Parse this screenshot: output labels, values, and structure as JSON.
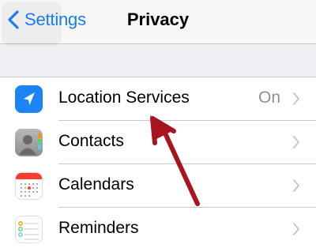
{
  "navbar": {
    "back_label": "Settings",
    "title": "Privacy"
  },
  "rows": [
    {
      "label": "Location Services",
      "value": "On",
      "icon": "location-arrow-icon"
    },
    {
      "label": "Contacts",
      "value": "",
      "icon": "contacts-icon"
    },
    {
      "label": "Calendars",
      "value": "",
      "icon": "calendar-icon"
    },
    {
      "label": "Reminders",
      "value": "",
      "icon": "reminders-icon"
    }
  ],
  "colors": {
    "accent": "#1a7cf5",
    "annotation_arrow": "#a8141f"
  }
}
